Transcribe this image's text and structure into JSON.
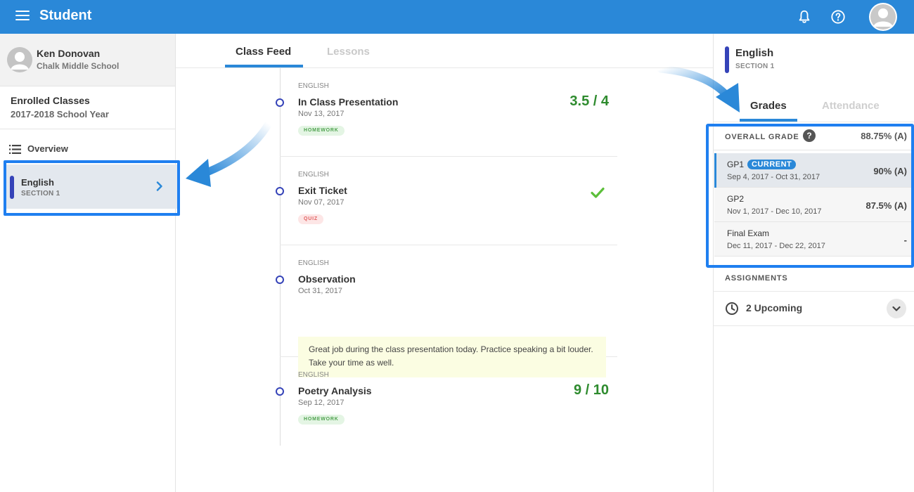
{
  "app": {
    "title": "Student"
  },
  "colors": {
    "topbar": "#2a88d8",
    "accent": "#3543b8",
    "score_green": "#2e8b2e",
    "highlight": "#1f7ff0"
  },
  "icons": [
    "menu-icon",
    "bell-icon",
    "help-icon",
    "avatar",
    "list-icon",
    "chevron-right-icon",
    "check-icon",
    "question-icon",
    "clock-icon",
    "chevron-down-icon"
  ],
  "sidebar": {
    "user_name": "Ken Donovan",
    "school": "Chalk Middle School",
    "enrolled_title": "Enrolled Classes",
    "school_year": "2017-2018 School Year",
    "overview_label": "Overview",
    "classes": [
      {
        "name": "English",
        "section": "SECTION 1"
      }
    ]
  },
  "feed": {
    "tabs": [
      "Class Feed",
      "Lessons"
    ],
    "items": [
      {
        "subject": "ENGLISH",
        "title": "In Class Presentation",
        "date": "Nov 13, 2017",
        "badge": "HOMEWORK",
        "score": "3.5 / 4"
      },
      {
        "subject": "ENGLISH",
        "title": "Exit Ticket",
        "date": "Nov 07, 2017",
        "badge": "QUIZ"
      },
      {
        "subject": "ENGLISH",
        "title": "Observation",
        "date": "Oct 31, 2017",
        "note": "Great job during the class presentation today. Practice speaking a bit louder. Take your time as well."
      },
      {
        "subject": "ENGLISH",
        "title": "Poetry Analysis",
        "date": "Sep 12, 2017",
        "badge": "HOMEWORK",
        "score": "9 / 10"
      }
    ]
  },
  "right": {
    "class_name": "English",
    "section": "SECTION 1",
    "tabs": [
      "Grades",
      "Attendance"
    ],
    "overall_label": "OVERALL GRADE",
    "overall_value": "88.75% (A)",
    "periods": [
      {
        "name": "GP1",
        "badge": "CURRENT",
        "dates": "Sep 4, 2017 - Oct 31, 2017",
        "value": "90% (A)"
      },
      {
        "name": "GP2",
        "dates": "Nov 1, 2017 - Dec 10, 2017",
        "value": "87.5% (A)"
      },
      {
        "name": "Final Exam",
        "dates": "Dec 11, 2017 - Dec 22, 2017",
        "value": "-"
      }
    ],
    "assignments_label": "ASSIGNMENTS",
    "upcoming": "2 Upcoming"
  }
}
